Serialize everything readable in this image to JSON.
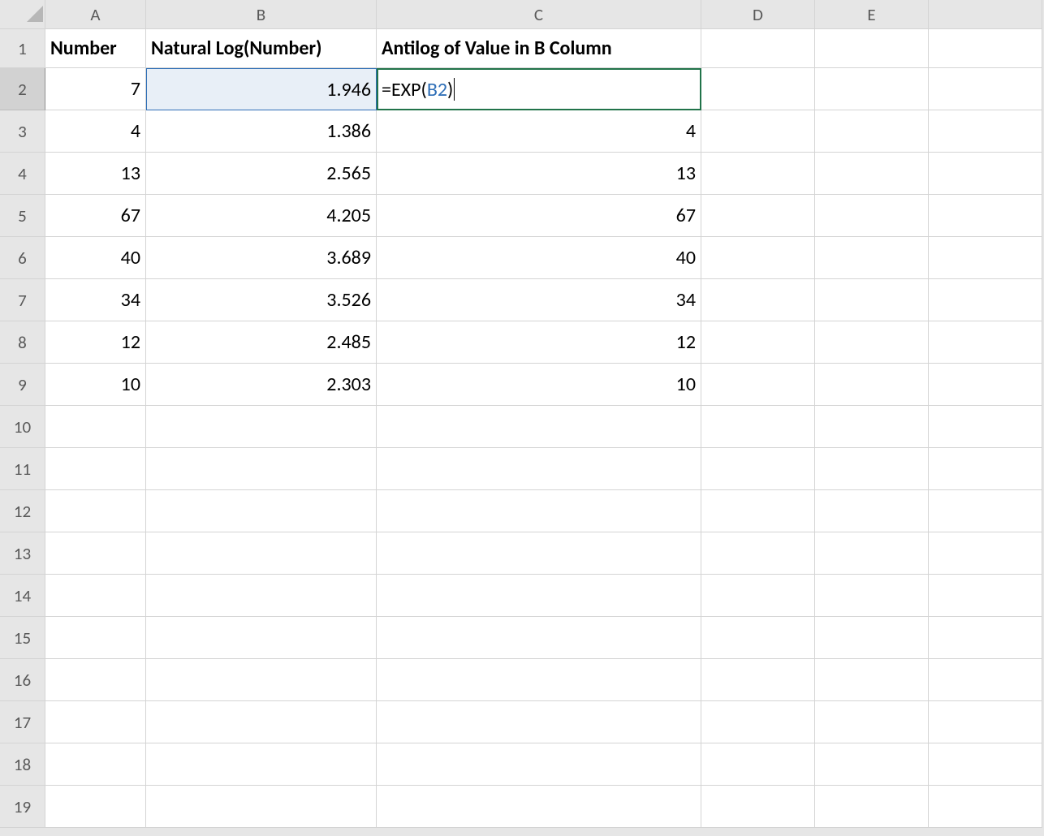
{
  "columns": {
    "A": "A",
    "B": "B",
    "C": "C",
    "D": "D",
    "E": "E"
  },
  "rowheads": [
    "1",
    "2",
    "3",
    "4",
    "5",
    "6",
    "7",
    "8",
    "9",
    "10",
    "11",
    "12",
    "13",
    "14",
    "15",
    "16",
    "17",
    "18",
    "19"
  ],
  "header": {
    "A": "Number",
    "B": "Natural Log(Number)",
    "C": "Antilog of Value in B Column"
  },
  "rows": [
    {
      "A": "7",
      "B": "1.946",
      "C": ""
    },
    {
      "A": "4",
      "B": "1.386",
      "C": "4"
    },
    {
      "A": "13",
      "B": "2.565",
      "C": "13"
    },
    {
      "A": "67",
      "B": "4.205",
      "C": "67"
    },
    {
      "A": "40",
      "B": "3.689",
      "C": "40"
    },
    {
      "A": "34",
      "B": "3.526",
      "C": "34"
    },
    {
      "A": "12",
      "B": "2.485",
      "C": "12"
    },
    {
      "A": "10",
      "B": "2.303",
      "C": "10"
    }
  ],
  "editing": {
    "cell": "C2",
    "formula_prefix": "=EXP(",
    "formula_ref": "B2",
    "formula_suffix": ")"
  }
}
